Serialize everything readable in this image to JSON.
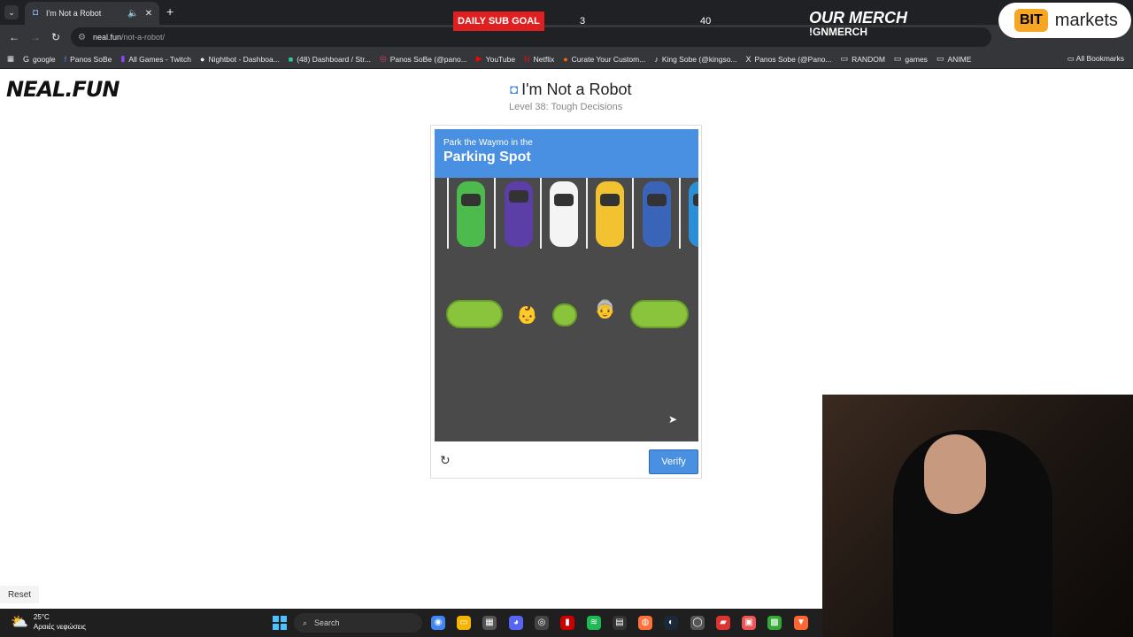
{
  "browser": {
    "tab_title": "I'm Not a Robot",
    "url_host": "neal.fun",
    "url_path": "/not-a-robot/",
    "bookmarks": [
      "google",
      "Panos SoBe",
      "All Games - Twitch",
      "Nightbot - Dashboa...",
      "(48) Dashboard / Str...",
      "Panos SoBe (@pano...",
      "YouTube",
      "Netflix",
      "Curate Your Custom...",
      "King Sobe (@kingso...",
      "Panos Sobe (@Pano...",
      "RANDOM",
      "games",
      "ANIME"
    ],
    "all_bookmarks": "All Bookmarks"
  },
  "overlay": {
    "goal_label": "DAILY SUB GOAL",
    "goal_current": "3",
    "goal_max": "40",
    "merch_line1": "OUR MERCH",
    "merch_line2": "!GNMERCH",
    "sponsor_logo": "BIT",
    "sponsor_text": "markets"
  },
  "page": {
    "logo": "NEAL.FUN",
    "title": "I'm Not a Robot",
    "subtitle": "Level 38: Tough Decisions",
    "captcha": {
      "instruction": "Park the Waymo in the",
      "target": "Parking Spot",
      "verify_label": "Verify"
    },
    "reset_label": "Reset"
  },
  "taskbar": {
    "temperature": "25°C",
    "weather_desc": "Αραιές νεφώσεις",
    "search_label": "Search"
  },
  "colors": {
    "captcha_header": "#4a90e2",
    "verify_button": "#4a90e2",
    "goal_red": "#e02020"
  }
}
